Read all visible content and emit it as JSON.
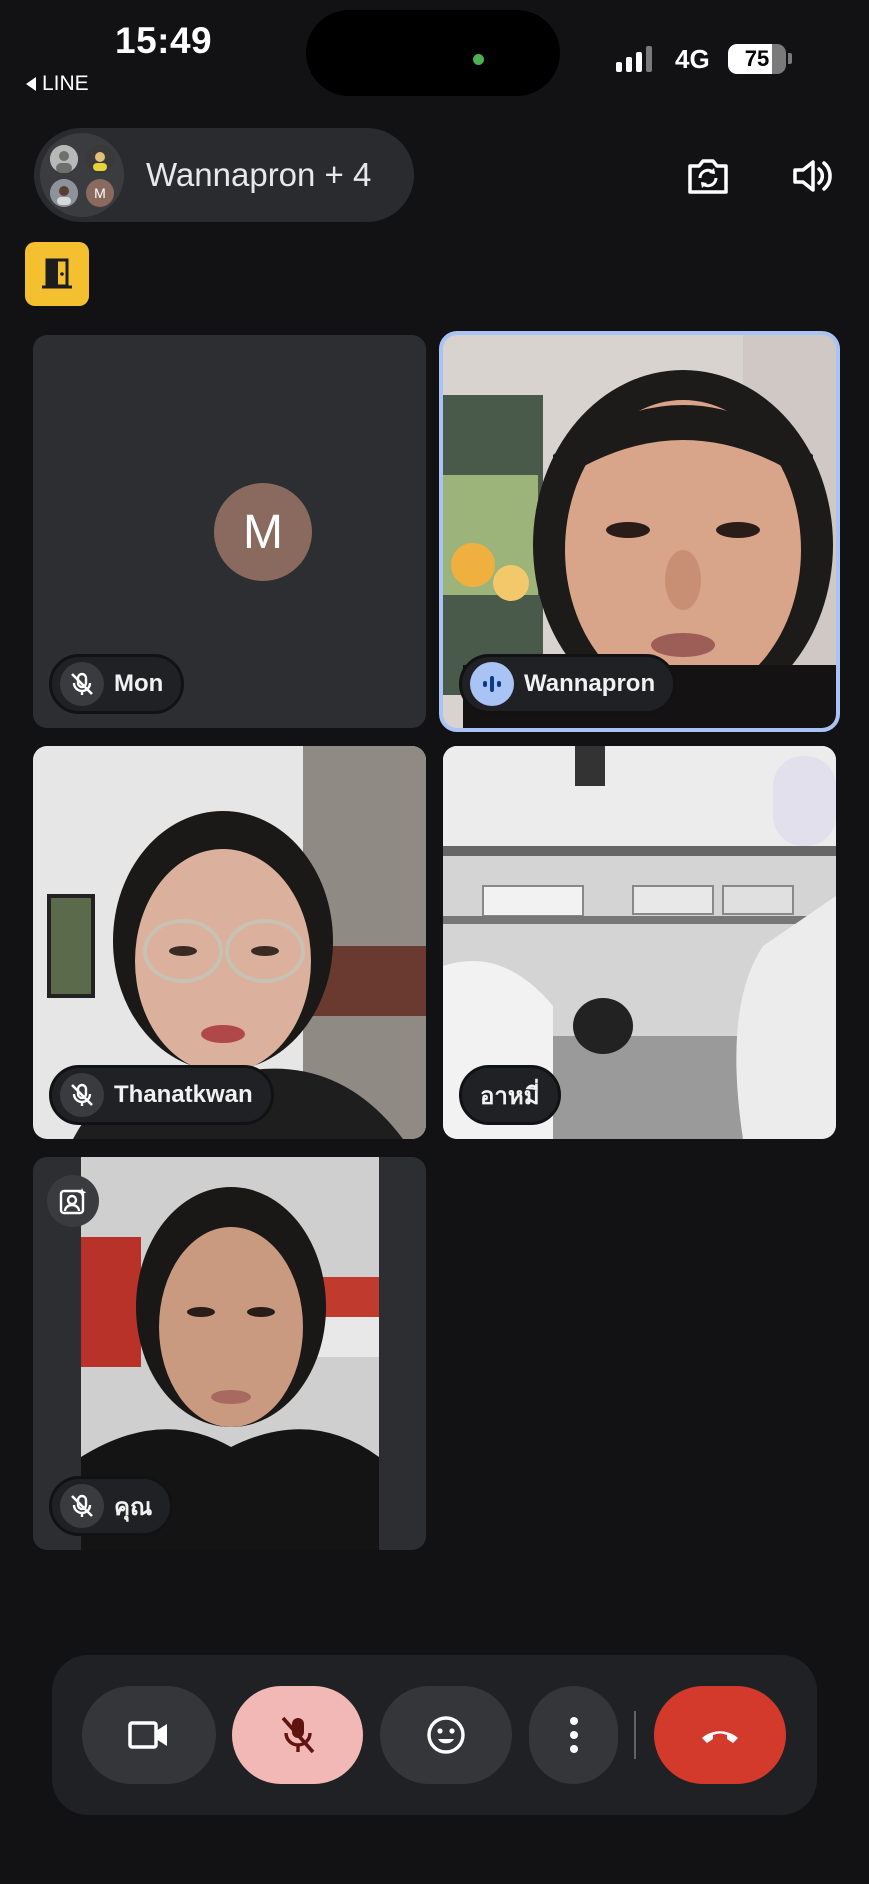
{
  "status_bar": {
    "time": "15:49",
    "back_app": "LINE",
    "network": "4G",
    "battery": "75",
    "battery_level": 0.75
  },
  "header": {
    "call_title": "Wannapron + 4",
    "cluster_avatar_initial": "M"
  },
  "participants": [
    {
      "name": "Mon",
      "avatar_initial": "M",
      "avatar_color": "#8a6a5e",
      "muted": true
    },
    {
      "name": "Wannapron",
      "speaking": true
    },
    {
      "name": "Thanatkwan",
      "muted": true
    },
    {
      "name": "อาหมี่"
    },
    {
      "name": "คุณ",
      "muted": true,
      "self": true
    }
  ],
  "colors": {
    "background": "#121214",
    "tile": "#2d2e31",
    "active_outline": "#a9c3f4",
    "door_button": "#f4c030",
    "mic_off_active": "#f2b8b5",
    "end_call": "#d33a2c"
  },
  "icons": {
    "camera_flip": "camera-flip-icon",
    "speaker": "speaker-icon",
    "door": "door-icon",
    "video": "video-icon",
    "mic_off": "mic-off-icon",
    "emoji": "emoji-icon",
    "more": "more-vert-icon",
    "end_call": "end-call-icon"
  }
}
